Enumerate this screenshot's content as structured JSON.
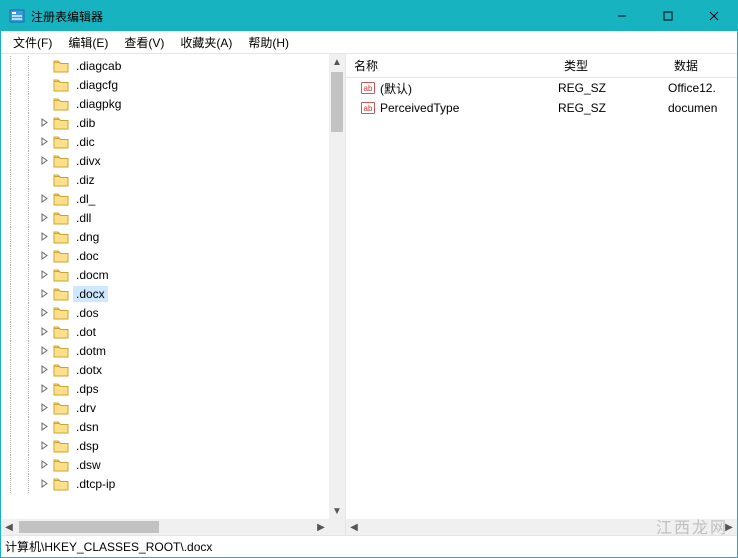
{
  "window": {
    "title": "注册表编辑器"
  },
  "menus": [
    {
      "label": "文件(F)"
    },
    {
      "label": "编辑(E)"
    },
    {
      "label": "查看(V)"
    },
    {
      "label": "收藏夹(A)"
    },
    {
      "label": "帮助(H)"
    }
  ],
  "tree": {
    "selected": ".docx",
    "items": [
      {
        "label": ".diagcab",
        "expandable": false
      },
      {
        "label": ".diagcfg",
        "expandable": false
      },
      {
        "label": ".diagpkg",
        "expandable": false
      },
      {
        "label": ".dib",
        "expandable": true
      },
      {
        "label": ".dic",
        "expandable": true
      },
      {
        "label": ".divx",
        "expandable": true
      },
      {
        "label": ".diz",
        "expandable": false
      },
      {
        "label": ".dl_",
        "expandable": true
      },
      {
        "label": ".dll",
        "expandable": true
      },
      {
        "label": ".dng",
        "expandable": true
      },
      {
        "label": ".doc",
        "expandable": true
      },
      {
        "label": ".docm",
        "expandable": true
      },
      {
        "label": ".docx",
        "expandable": true,
        "selected": true
      },
      {
        "label": ".dos",
        "expandable": true
      },
      {
        "label": ".dot",
        "expandable": true
      },
      {
        "label": ".dotm",
        "expandable": true
      },
      {
        "label": ".dotx",
        "expandable": true
      },
      {
        "label": ".dps",
        "expandable": true
      },
      {
        "label": ".drv",
        "expandable": true
      },
      {
        "label": ".dsn",
        "expandable": true
      },
      {
        "label": ".dsp",
        "expandable": true
      },
      {
        "label": ".dsw",
        "expandable": true
      },
      {
        "label": ".dtcp-ip",
        "expandable": true
      }
    ]
  },
  "list": {
    "columns": {
      "name": "名称",
      "type": "类型",
      "data": "数据"
    },
    "rows": [
      {
        "name": "(默认)",
        "type": "REG_SZ",
        "data": "Office12."
      },
      {
        "name": "PerceivedType",
        "type": "REG_SZ",
        "data": "documen"
      }
    ]
  },
  "statusbar": {
    "path": "计算机\\HKEY_CLASSES_ROOT\\.docx"
  },
  "watermark": "江西龙网"
}
